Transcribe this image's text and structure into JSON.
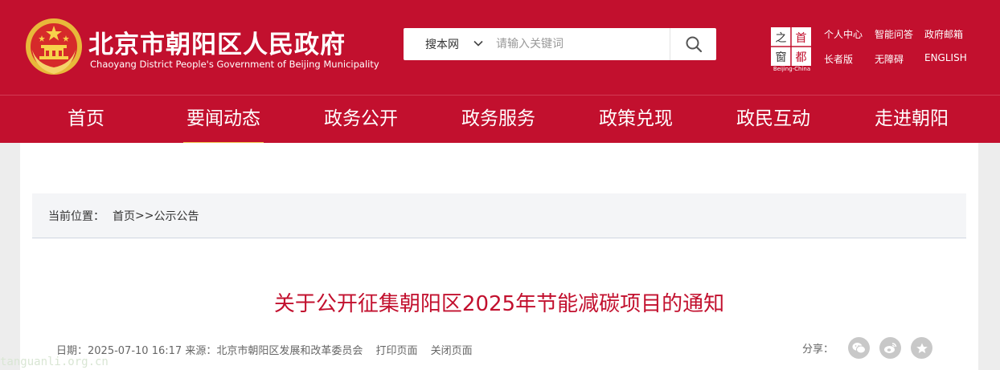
{
  "header": {
    "title": "北京市朝阳区人民政府",
    "subtitle": "Chaoyang District People's Government of Beijing Municipality",
    "brand_color": "#c2102e",
    "emblem_icon": "national-emblem-icon"
  },
  "search": {
    "scope": "搜本网",
    "placeholder": "请输入关键词",
    "button_icon": "search-icon"
  },
  "capital_logo": {
    "chars": [
      "首",
      "都",
      "之",
      "窗"
    ],
    "caption": "Beijing-China"
  },
  "top_links": [
    {
      "label": "个人中心"
    },
    {
      "label": "智能问答"
    },
    {
      "label": "政府邮箱"
    },
    {
      "label": "长者版"
    },
    {
      "label": "无障碍"
    },
    {
      "label": "ENGLISH"
    }
  ],
  "nav": {
    "active_index": 1,
    "active_underline_color": "#f0c14b",
    "items": [
      {
        "label": "首页"
      },
      {
        "label": "要闻动态"
      },
      {
        "label": "政务公开"
      },
      {
        "label": "政务服务"
      },
      {
        "label": "政策兑现"
      },
      {
        "label": "政民互动"
      },
      {
        "label": "走进朝阳"
      }
    ]
  },
  "breadcrumb": {
    "prefix": "当前位置：",
    "home": "首页",
    "separator": ">>",
    "current": "公示公告"
  },
  "article": {
    "title": "关于公开征集朝阳区2025年节能减碳项目的通知",
    "title_color": "#c2102e",
    "meta": {
      "date_label": "日期：",
      "date": "2025-07-10 16:17",
      "source_label": "来源：",
      "source": "北京市朝阳区发展和改革委员会",
      "print_label": "打印页面",
      "close_label": "关闭页面"
    },
    "share": {
      "label": "分享：",
      "icons": [
        "wechat-icon",
        "weibo-icon",
        "favorite-star-icon"
      ]
    }
  },
  "watermark": "tanguanli.org.cn"
}
